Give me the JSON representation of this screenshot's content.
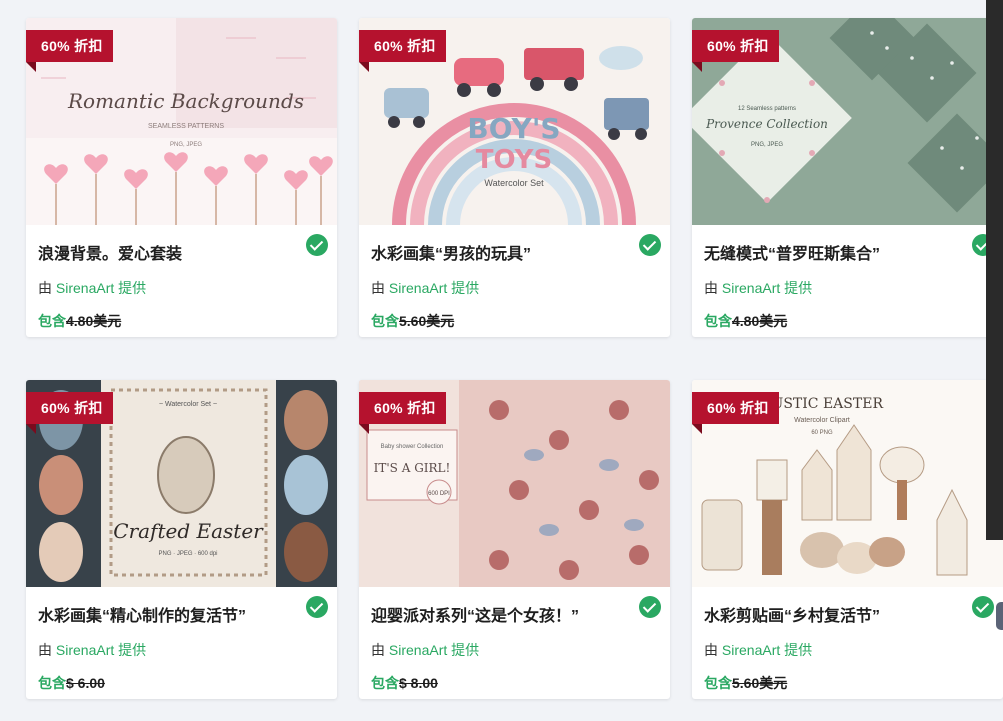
{
  "colors": {
    "accent_green": "#2aa862",
    "ribbon_red": "#b5122e",
    "page_bg": "#f1f3f7"
  },
  "cards": [
    {
      "badge": "60% 折扣",
      "title": "浪漫背景。爱心套装",
      "by": "由",
      "author": "SirenaArt 提供",
      "included": "包含",
      "old_price": "4.80美元",
      "thumb": {
        "theme": "hearts",
        "text1": "Romantic Backgrounds",
        "text2": "SEAMLESS   PATTERNS",
        "text3": "PNG, JPEG"
      }
    },
    {
      "badge": "60% 折扣",
      "title": "水彩画集“男孩的玩具”",
      "by": "由",
      "author": "SirenaArt 提供",
      "included": "包含",
      "old_price": "5.60美元",
      "thumb": {
        "theme": "toys",
        "text1": "BOY'S",
        "text2": "TOYS",
        "text3": "Watercolor Set"
      }
    },
    {
      "badge": "60% 折扣",
      "title": "无缝模式“普罗旺斯集合”",
      "by": "由",
      "author": "SirenaArt 提供",
      "included": "包含",
      "old_price": "4.80美元",
      "thumb": {
        "theme": "provence",
        "text1": "Provence Collection",
        "text2": "12 Seamless patterns",
        "text3": "PNG, JPEG"
      }
    },
    {
      "badge": "60% 折扣",
      "title": "水彩画集“精心制作的复活节”",
      "by": "由",
      "author": "SirenaArt 提供",
      "included": "包含",
      "old_price": "$ 6.00",
      "thumb": {
        "theme": "crafted",
        "text1": "Crafted Easter",
        "text2": "~ Watercolor Set ~",
        "text3": "PNG · JPEG · 600 dpi"
      }
    },
    {
      "badge": "60% 折扣",
      "title": "迎婴派对系列“这是个女孩！”",
      "by": "由",
      "author": "SirenaArt 提供",
      "included": "包含",
      "old_price": "$ 8.00",
      "thumb": {
        "theme": "girl",
        "text1": "IT'S A GIRL!",
        "text2": "Baby shower Collection",
        "text3": "600 DPI"
      }
    },
    {
      "badge": "60% 折扣",
      "title": "水彩剪贴画“乡村复活节”",
      "by": "由",
      "author": "SirenaArt 提供",
      "included": "包含",
      "old_price": "5.60美元",
      "thumb": {
        "theme": "rustic",
        "text1": "RUSTIC EASTER",
        "text2": "Watercolor Clipart",
        "text3": "60 PNG"
      }
    }
  ]
}
